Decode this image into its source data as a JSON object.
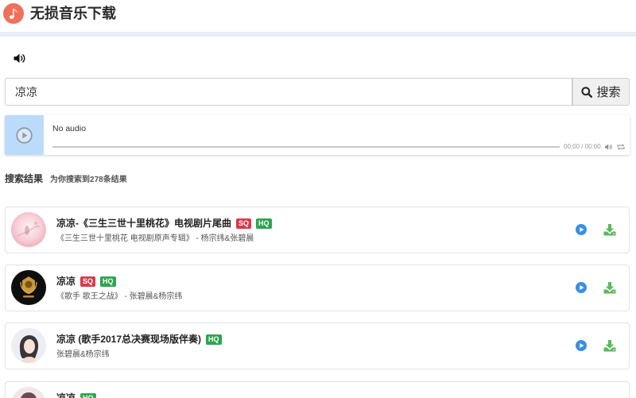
{
  "header": {
    "title": "无损音乐下载",
    "logo_icon": "music-note-icon"
  },
  "volume_toggle": {
    "icon": "speaker-icon"
  },
  "search": {
    "value": "凉凉",
    "button_label": "搜索",
    "button_icon": "search-icon"
  },
  "player": {
    "status": "No audio",
    "time": "00:00 / 00:00",
    "progress": 0,
    "icons": [
      "play-circle-icon",
      "volume-icon",
      "loop-icon"
    ]
  },
  "results": {
    "heading": "搜索结果",
    "summary": "为你搜索到278条结果",
    "item_actions": [
      "play-icon",
      "download-icon"
    ],
    "items": [
      {
        "title": "凉凉-《三生三世十里桃花》电视剧片尾曲",
        "badges": [
          "SQ",
          "HQ"
        ],
        "subtitle": "《三生三世十里桃花 电视剧原声专辑》 - 杨宗纬&张碧晨"
      },
      {
        "title": "凉凉",
        "badges": [
          "SQ",
          "HQ"
        ],
        "subtitle": "《歌手 歌王之战》 - 张碧晨&杨宗纬"
      },
      {
        "title": "凉凉 (歌手2017总决赛现场版伴奏)",
        "badges": [
          "HQ"
        ],
        "subtitle": "张碧晨&杨宗纬"
      },
      {
        "title": "凉凉",
        "badges": [
          "HQ"
        ]
      }
    ]
  },
  "colors": {
    "logo": "#f0705c",
    "header_divider": "#e8ecf5",
    "player_cover": "#bcdbfb",
    "badge_sq": "#d9394b",
    "badge_hq": "#2ea44f",
    "play": "#3a8ee6",
    "download": "#5cb85c"
  }
}
